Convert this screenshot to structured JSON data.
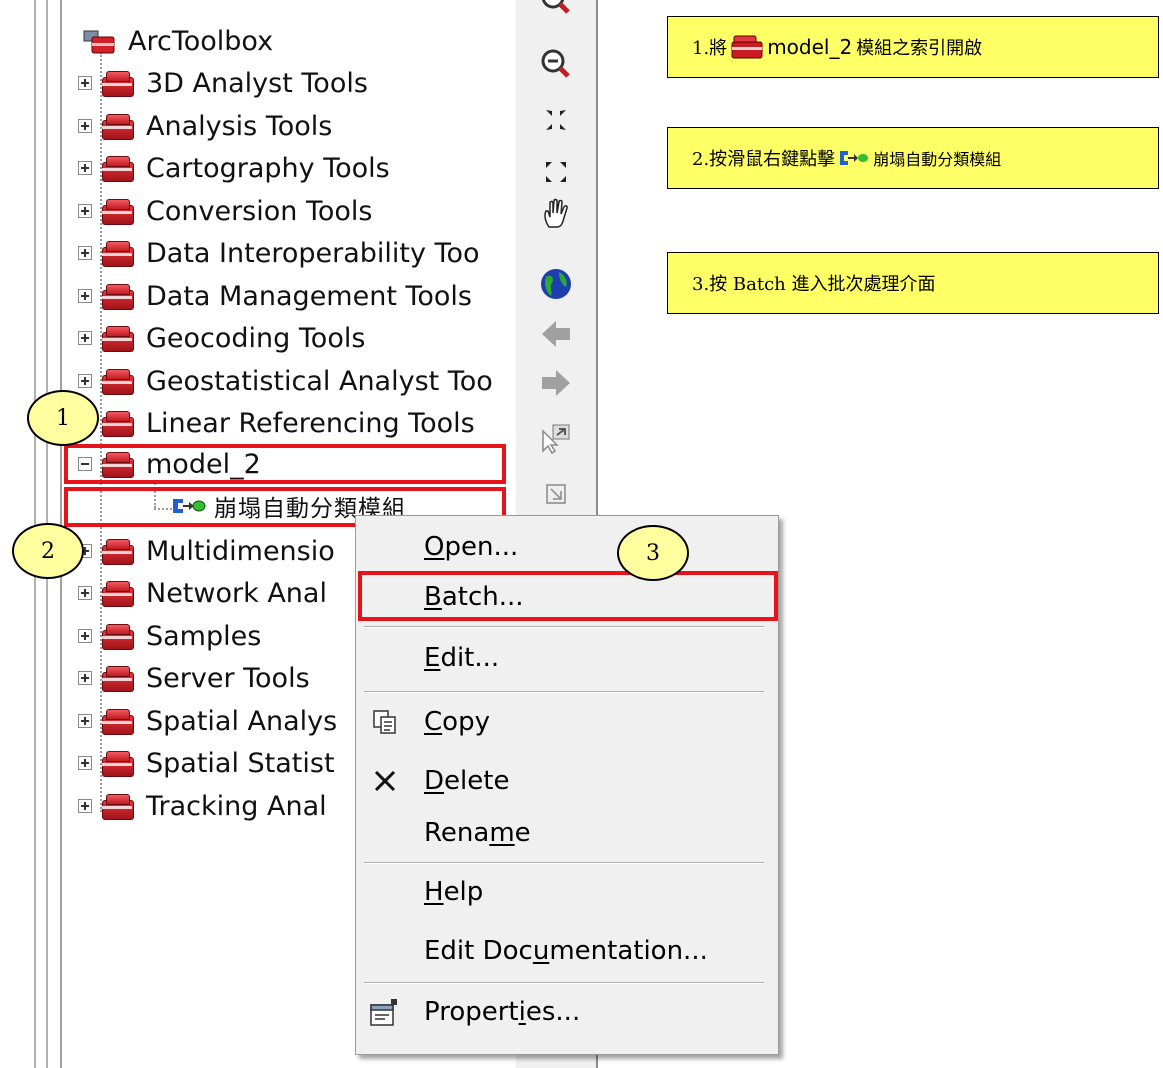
{
  "tree": {
    "root_label": "ArcToolbox",
    "toolboxes": [
      "3D Analyst Tools",
      "Analysis Tools",
      "Cartography Tools",
      "Conversion Tools",
      "Data Interoperability Too",
      "Data Management Tools",
      "Geocoding Tools",
      "Geostatistical Analyst Too",
      "Linear Referencing Tools",
      "model_2",
      "Multidimensio",
      "Network Anal",
      "Samples",
      "Server Tools",
      "Spatial Analys",
      "Spatial Statist",
      "Tracking Anal"
    ],
    "model_tool_label": "崩塌自動分類模組"
  },
  "callouts": {
    "c1": "1",
    "c2": "2",
    "c3": "3"
  },
  "notes": {
    "n1_prefix": "1.將",
    "n1_tool": "model_2",
    "n1_suffix": "模組之索引開啟",
    "n2_prefix": "2.按滑鼠右鍵點擊",
    "n2_tool": "崩塌自動分類模組",
    "n3": "3.按 Batch 進入批次處理介面"
  },
  "context_menu": {
    "open": {
      "pre": "",
      "ul": "O",
      "post": "pen..."
    },
    "batch": {
      "pre": "",
      "ul": "B",
      "post": "atch..."
    },
    "edit": {
      "pre": "",
      "ul": "E",
      "post": "dit..."
    },
    "copy": {
      "pre": "",
      "ul": "C",
      "post": "opy"
    },
    "delete": {
      "pre": "",
      "ul": "D",
      "post": "elete"
    },
    "rename": {
      "pre": "Rena",
      "ul": "m",
      "post": "e"
    },
    "help": {
      "pre": "",
      "ul": "H",
      "post": "elp"
    },
    "edit_doc": {
      "pre": "Edit Doc",
      "ul": "u",
      "post": "mentation..."
    },
    "properties": {
      "pre": "Propert",
      "ul": "i",
      "post": "es..."
    }
  },
  "colors": {
    "highlight": "#e8121a",
    "note_bg": "#ffff66",
    "callout_bg": "#ffffa0"
  }
}
